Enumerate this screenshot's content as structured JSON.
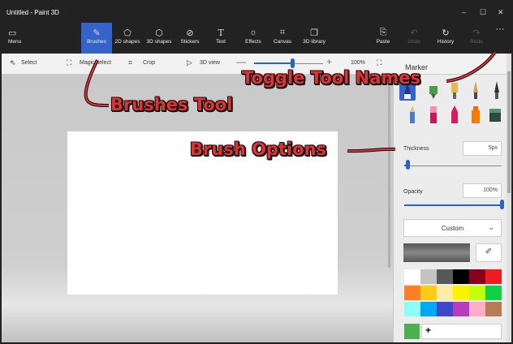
{
  "window": {
    "title": "Untitled - Paint 3D",
    "controls": {
      "minimize": "–",
      "maximize": "☐",
      "close": "✕"
    }
  },
  "ribbon": {
    "menu": {
      "icon": "menu-icon",
      "label": "Menu"
    },
    "tools": [
      {
        "icon": "brush-icon",
        "label": "Brushes",
        "active": true
      },
      {
        "icon": "2d-shapes-icon",
        "label": "2D shapes"
      },
      {
        "icon": "3d-shapes-icon",
        "label": "3D shapes"
      },
      {
        "icon": "stickers-icon",
        "label": "Stickers"
      },
      {
        "icon": "text-icon",
        "label": "Text"
      },
      {
        "icon": "effects-icon",
        "label": "Effects"
      },
      {
        "icon": "canvas-icon",
        "label": "Canvas"
      },
      {
        "icon": "3d-library-icon",
        "label": "3D library"
      }
    ],
    "right": [
      {
        "icon": "paste-icon",
        "label": "Paste"
      },
      {
        "icon": "undo-icon",
        "label": "Undo",
        "disabled": true
      },
      {
        "icon": "history-icon",
        "label": "History"
      },
      {
        "icon": "redo-icon",
        "label": "Redo",
        "disabled": true
      }
    ],
    "more": "···"
  },
  "toolbar": {
    "select": "Select",
    "magic_select": "Magic select",
    "crop": "Crop",
    "view_3d": "3D view",
    "zoom_out": "—",
    "zoom_in": "+",
    "zoom_level": "100%",
    "zoom_value": 0.55
  },
  "panel": {
    "title": "Marker",
    "thickness_label": "Thickness",
    "thickness_value": "5px",
    "thickness_level": 0.03,
    "opacity_label": "Opacity",
    "opacity_value": "100%",
    "opacity_level": 1.0,
    "texture_select": "Custom",
    "palette": [
      "#ffffff",
      "#c3c3c3",
      "#585858",
      "#000000",
      "#88001b",
      "#ec1c24",
      "#ff7f27",
      "#ffca18",
      "#fdeca6",
      "#fff200",
      "#c4ff0e",
      "#0ed145",
      "#8cfffb",
      "#00a8f3",
      "#3f48cc",
      "#b83dba",
      "#ffaec8",
      "#b97a56"
    ],
    "current_color": "#4caf50",
    "add_color": "+"
  },
  "annotations": {
    "brushes_tool": "Brushes Tool",
    "toggle_tool_names": "Toggle Tool Names",
    "brush_options": "Brush Options"
  },
  "colors": {
    "accent": "#3563c9",
    "annotation_red": "#e03232"
  }
}
